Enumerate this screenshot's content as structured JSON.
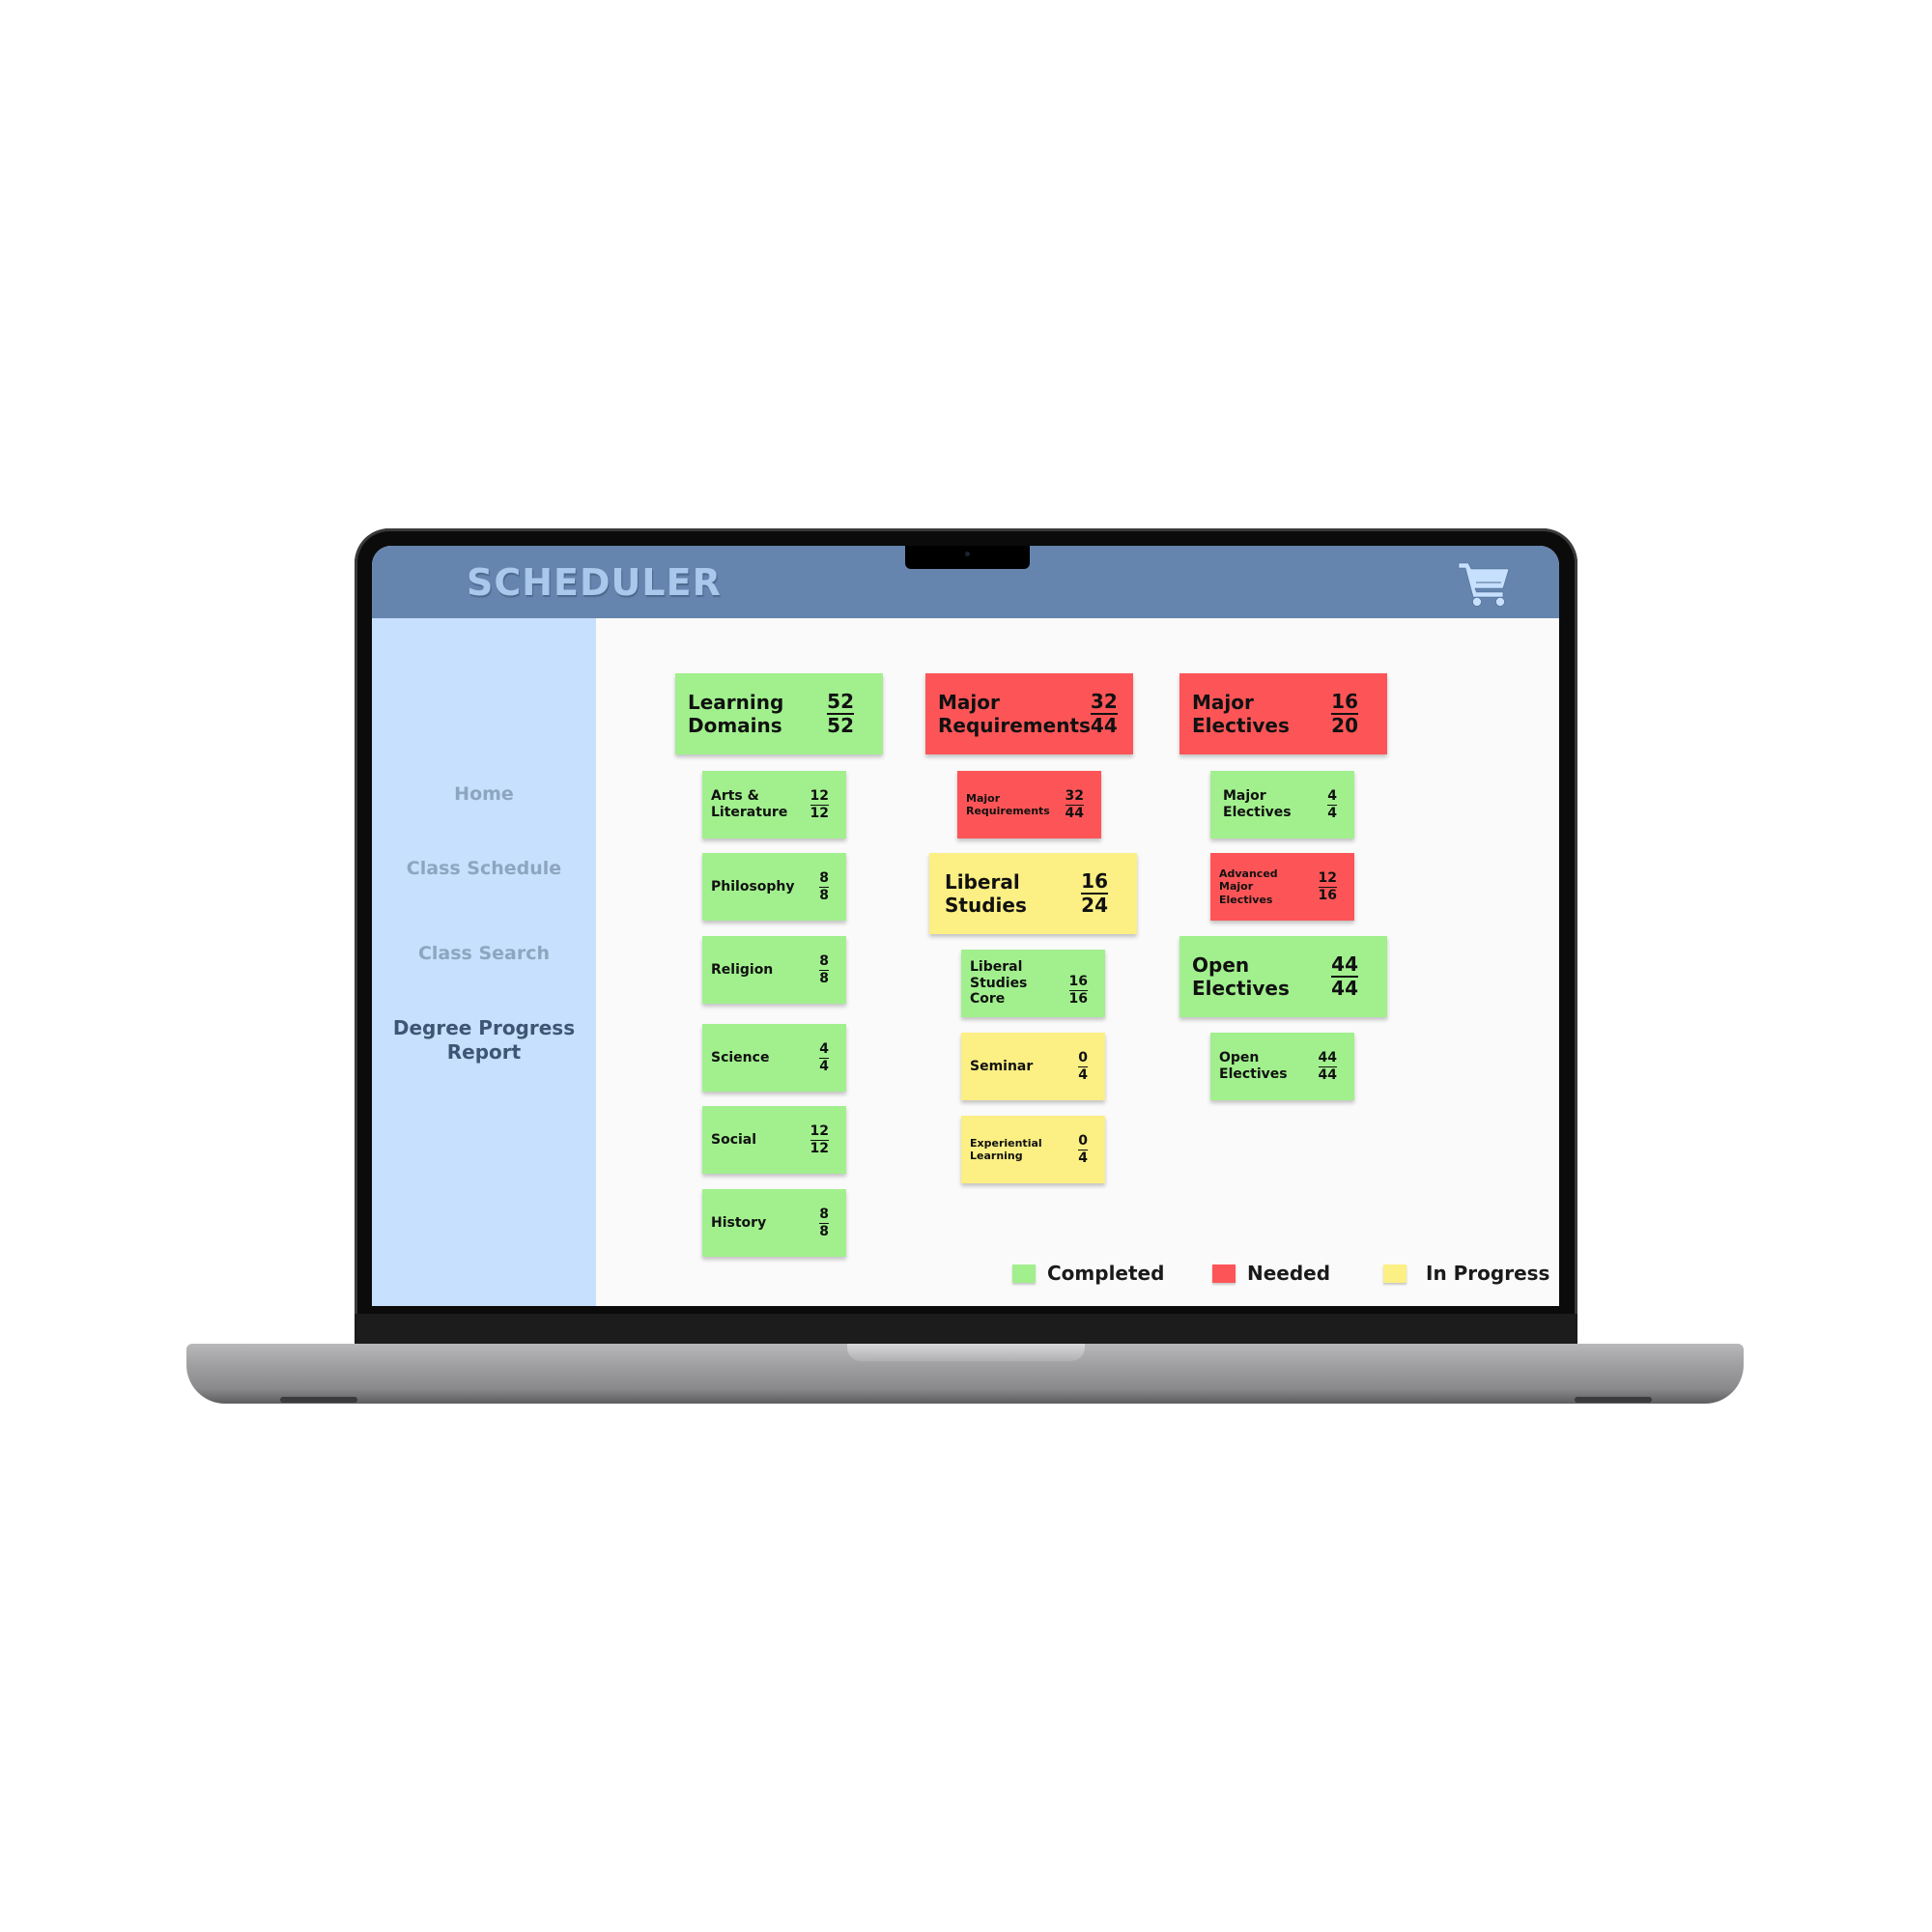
{
  "app": {
    "title": "SCHEDULER",
    "cart_icon": "shopping-cart-icon"
  },
  "sidebar": {
    "items": [
      {
        "label": "Home",
        "active": false
      },
      {
        "label": "Class Schedule",
        "active": false
      },
      {
        "label": "Class Search",
        "active": false
      },
      {
        "label": "Degree Progress\nReport",
        "active": true
      }
    ]
  },
  "colors": {
    "header": "#6585ae",
    "sidebar": "#c6e0fd",
    "completed": "#a1f08d",
    "needed": "#fd5557",
    "in_progress": "#fcef83"
  },
  "report": {
    "learning_domains": {
      "label": "Learning\nDomains",
      "earned": "52",
      "required": "52",
      "status": "completed",
      "children": [
        {
          "label": "Arts &\nLiterature",
          "earned": "12",
          "required": "12",
          "status": "completed"
        },
        {
          "label": "Philosophy",
          "earned": "8",
          "required": "8",
          "status": "completed"
        },
        {
          "label": "Religion",
          "earned": "8",
          "required": "8",
          "status": "completed"
        },
        {
          "label": "Science",
          "earned": "4",
          "required": "4",
          "status": "completed"
        },
        {
          "label": "Social",
          "earned": "12",
          "required": "12",
          "status": "completed"
        },
        {
          "label": "History",
          "earned": "8",
          "required": "8",
          "status": "completed"
        }
      ]
    },
    "major_requirements": {
      "label": "Major\nRequirements",
      "earned": "32",
      "required": "44",
      "status": "needed",
      "children": [
        {
          "label": "Major\nRequirements",
          "earned": "32",
          "required": "44",
          "status": "needed"
        }
      ]
    },
    "liberal_studies": {
      "label": "Liberal\nStudies",
      "earned": "16",
      "required": "24",
      "status": "in_progress",
      "children": [
        {
          "label": "Liberal\nStudies\nCore",
          "earned": "16",
          "required": "16",
          "status": "completed"
        },
        {
          "label": "Seminar",
          "earned": "0",
          "required": "4",
          "status": "in_progress"
        },
        {
          "label": "Experiential\nLearning",
          "earned": "0",
          "required": "4",
          "status": "in_progress"
        }
      ]
    },
    "major_electives": {
      "label": "Major\nElectives",
      "earned": "16",
      "required": "20",
      "status": "needed",
      "children": [
        {
          "label": "Major\nElectives",
          "earned": "4",
          "required": "4",
          "status": "completed"
        },
        {
          "label": "Advanced\nMajor\nElectives",
          "earned": "12",
          "required": "16",
          "status": "needed"
        }
      ]
    },
    "open_electives": {
      "label": "Open\nElectives",
      "earned": "44",
      "required": "44",
      "status": "completed",
      "children": [
        {
          "label": "Open\nElectives",
          "earned": "44",
          "required": "44",
          "status": "completed"
        }
      ]
    }
  },
  "legend": [
    {
      "label": "Completed",
      "status": "completed"
    },
    {
      "label": "Needed",
      "status": "needed"
    },
    {
      "label": "In Progress",
      "status": "in_progress"
    }
  ]
}
